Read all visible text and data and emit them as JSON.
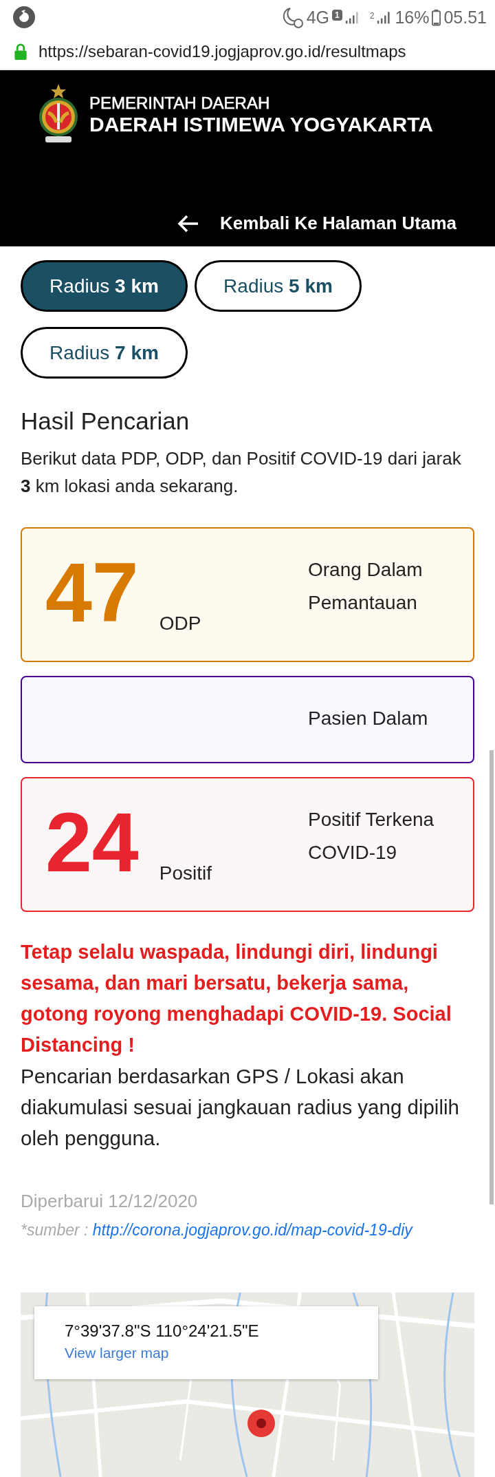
{
  "status_bar": {
    "network": "4G",
    "sim1": "1",
    "sim2": "2",
    "battery": "16%",
    "time": "05.51"
  },
  "address_bar": {
    "url": "https://sebaran-covid19.jogjaprov.go.id/resultmaps"
  },
  "header": {
    "line1": "PEMERINTAH DAERAH",
    "line2": "DAERAH ISTIMEWA YOGYAKARTA",
    "back_link": "Kembali Ke Halaman Utama"
  },
  "radius_options": [
    {
      "label": "Radius **3 km**",
      "selected": true
    },
    {
      "label": "Radius **5 km**",
      "selected": false
    },
    {
      "label": "Radius **7 km**",
      "selected": false
    }
  ],
  "results": {
    "title": "Hasil Pencarian",
    "description": "Berikut data PDP, ODP, dan Positif COVID-19 dari jarak **3** km lokasi anda sekarang."
  },
  "cards": [
    {
      "kind": "odp",
      "number": "47",
      "short": "ODP",
      "label": "Orang Dalam Pemantauan",
      "color": "#d97a00"
    },
    {
      "kind": "pdp",
      "label": "Pasien Dalam",
      "color": "#4b0096"
    },
    {
      "kind": "positive",
      "number": "24",
      "short": "Positif",
      "label": "Positif Terkena COVID-19",
      "color": "#e8242f"
    }
  ],
  "notice": {
    "warning": "Tetap selalu waspada, lindungi diri, lindungi sesama, dan mari bersatu, bekerja sama, gotong royong menghadapi COVID-19. Social Distancing !",
    "note": "Pencarian berdasarkan GPS / Lokasi akan diakumulasi sesuai jangkauan radius yang dipilih oleh pengguna."
  },
  "footer": {
    "updated": "Diperbarui 12/12/2020",
    "source_label": "*sumber :",
    "source_link": "http://corona.jogjaprov.go.id/map-covid-19-diy"
  },
  "map": {
    "coordinates": "7°39'37.8\"S 110°24'21.5\"E",
    "link": "View larger map"
  }
}
